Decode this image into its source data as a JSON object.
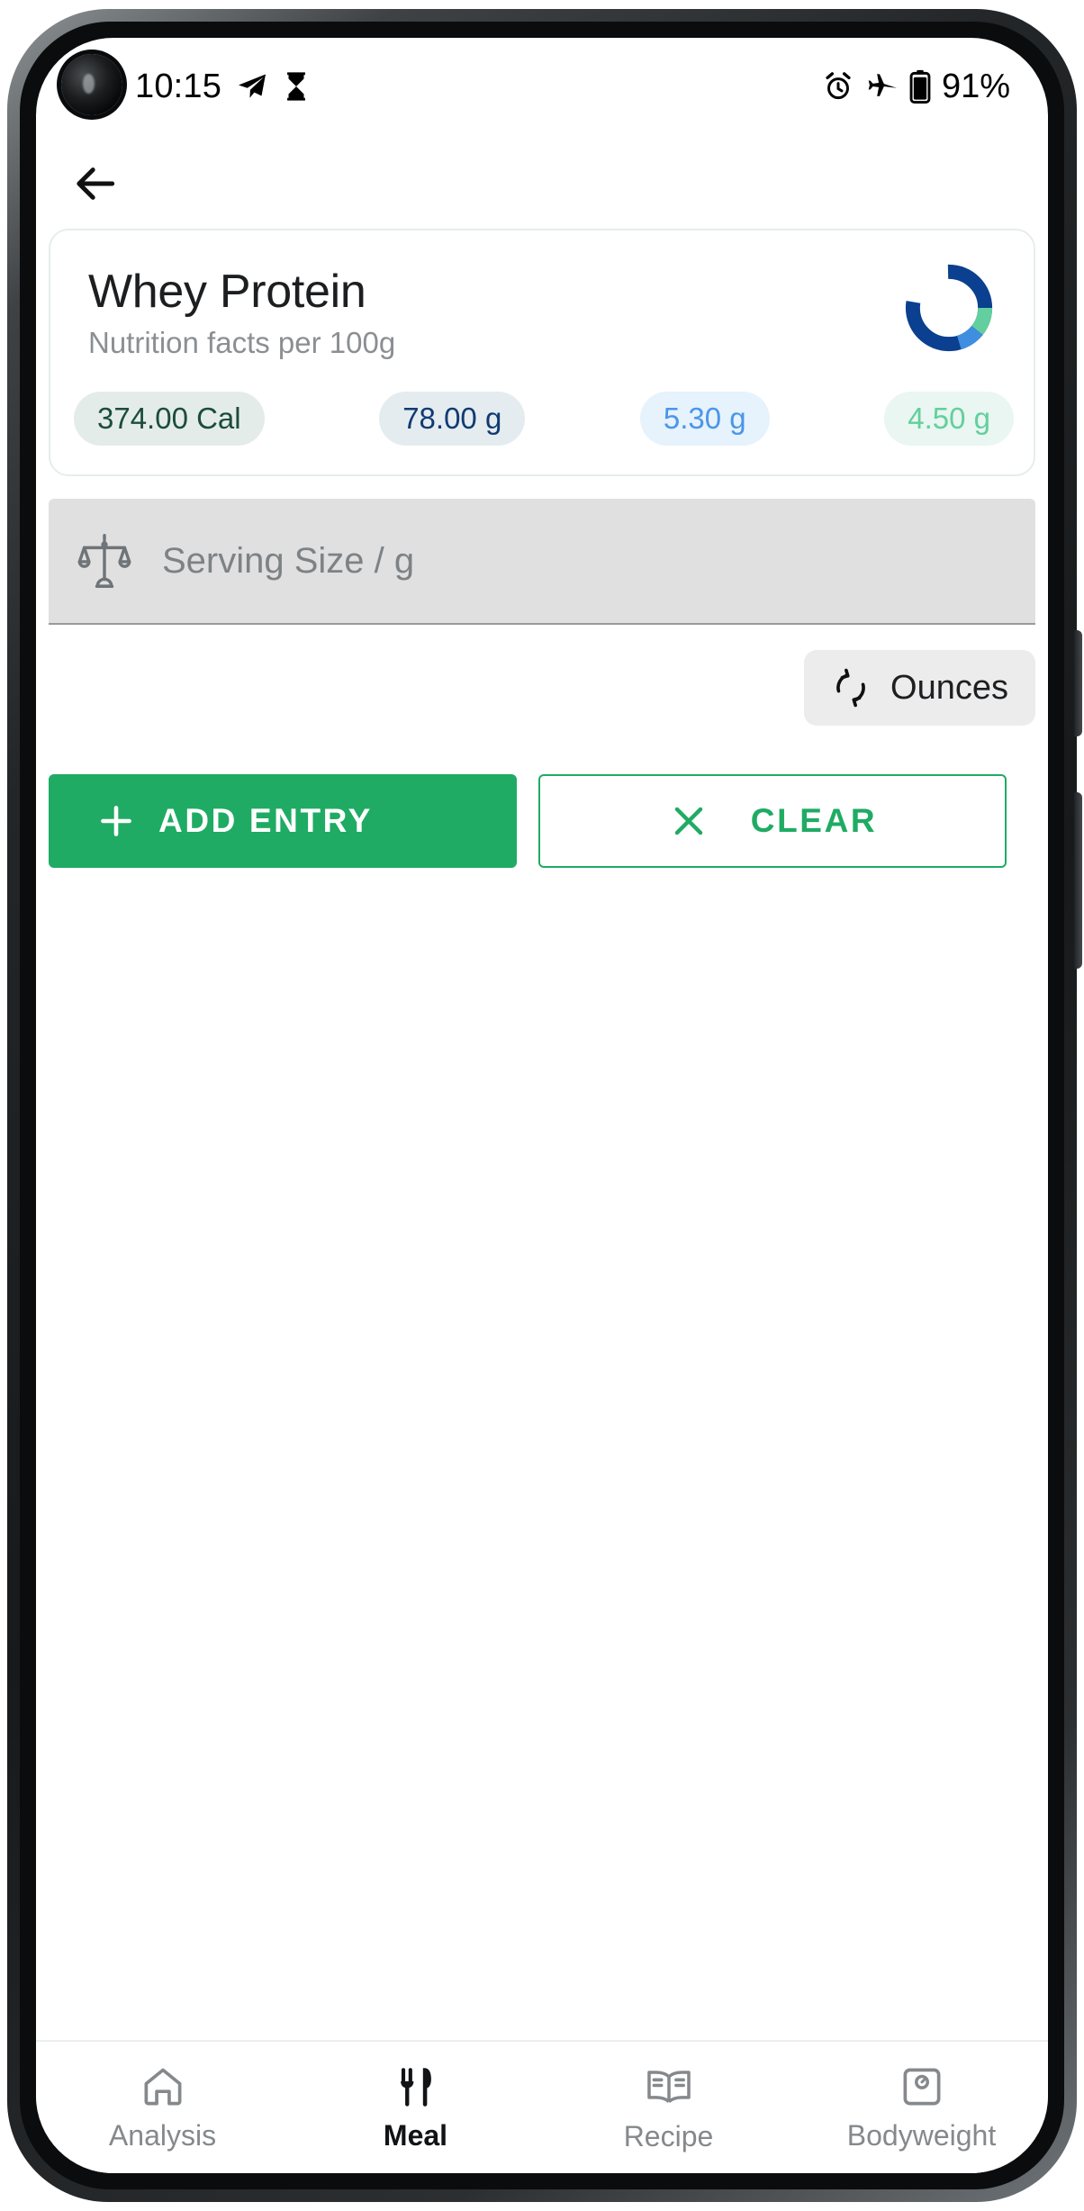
{
  "status_bar": {
    "time": "10:15",
    "battery_percent": "91%",
    "left_icons": [
      "telegram-send-icon",
      "hourglass-icon"
    ],
    "right_icons": [
      "alarm-clock-icon",
      "airplane-mode-icon",
      "battery-icon"
    ]
  },
  "appbar": {
    "back_icon": "arrow-left-icon"
  },
  "food_card": {
    "title": "Whey Protein",
    "subtitle": "Nutrition facts per 100g",
    "donut": {
      "colors": {
        "protein": "#0b3f8f",
        "carbs": "#3f8ee0",
        "fat": "#63cf9e",
        "track": "#ffffff"
      },
      "segments": [
        {
          "name": "protein",
          "percent": 78.0
        },
        {
          "name": "fat",
          "percent": 12.0
        },
        {
          "name": "carbs",
          "percent": 10.0
        }
      ]
    },
    "macros": [
      {
        "name": "calories",
        "value": "374.00 Cal",
        "text_color": "#1b4d3a",
        "bg_color": "#e4ecea"
      },
      {
        "name": "protein",
        "value": "78.00 g",
        "text_color": "#113a73",
        "bg_color": "#e4ecef"
      },
      {
        "name": "carbs",
        "value": "5.30 g",
        "text_color": "#4a96e8",
        "bg_color": "#e6f2fc"
      },
      {
        "name": "fat",
        "value": "4.50 g",
        "text_color": "#63cf9e",
        "bg_color": "#e9f6f1"
      }
    ]
  },
  "serving_input": {
    "icon": "balance-scale-icon",
    "placeholder": "Serving Size / g",
    "value": ""
  },
  "unit_toggle": {
    "icon": "swap-arrows-icon",
    "label": "Ounces"
  },
  "actions": {
    "add_icon": "plus-icon",
    "add_label": "ADD ENTRY",
    "clear_icon": "close-x-icon",
    "clear_label": "CLEAR",
    "accent_color": "#1fab63"
  },
  "bottom_nav": {
    "items": [
      {
        "label": "Analysis",
        "icon": "home-icon",
        "active": false
      },
      {
        "label": "Meal",
        "icon": "cutlery-icon",
        "active": true
      },
      {
        "label": "Recipe",
        "icon": "open-book-icon",
        "active": false
      },
      {
        "label": "Bodyweight",
        "icon": "scale-icon",
        "active": false
      }
    ]
  }
}
